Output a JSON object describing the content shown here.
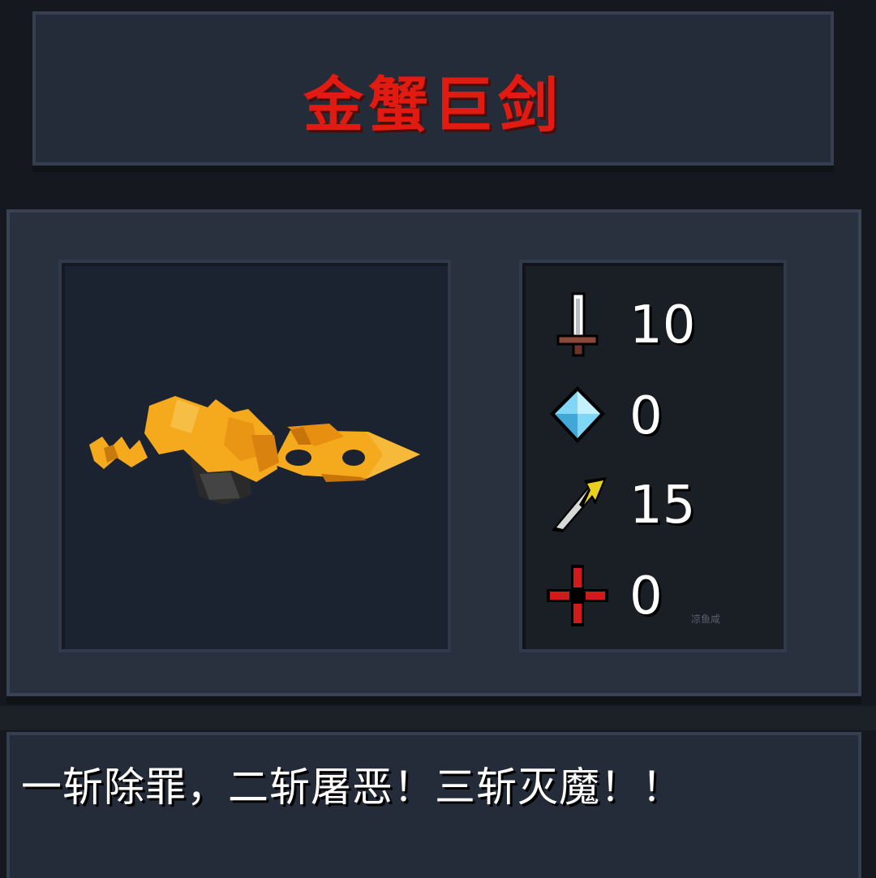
{
  "weapon": {
    "name": "金蟹巨剑",
    "description": "一斩除罪，二斩屠恶！三斩灭魔！！",
    "sprite_icon": "golden-crab-greatsword-sprite"
  },
  "stats": [
    {
      "icon": "sword-icon",
      "stat": "damage",
      "value": "10"
    },
    {
      "icon": "blue-crystal-icon",
      "stat": "energy",
      "value": "0"
    },
    {
      "icon": "feather-lightning-icon",
      "stat": "critical",
      "value": "15"
    },
    {
      "icon": "red-crosshair-icon",
      "stat": "accuracy",
      "value": "0"
    }
  ],
  "watermark": "凉鱼咸",
  "colors": {
    "title": "#e11b12",
    "background": "#15181e",
    "panel": "#252c39",
    "stat_text": "#ffffff",
    "weapon_gold": "#f2a820"
  }
}
